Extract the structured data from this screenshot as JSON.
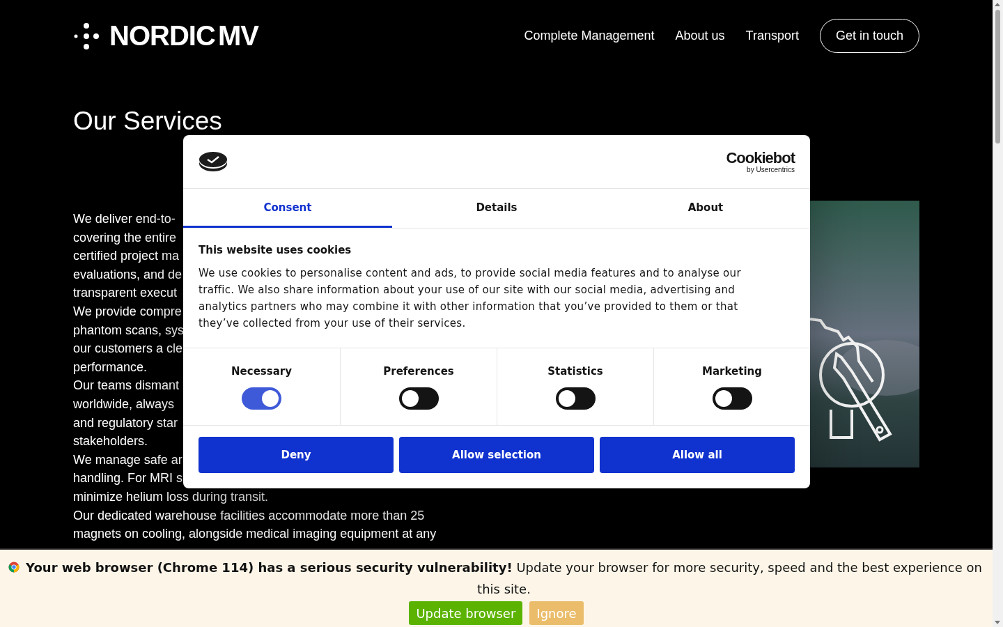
{
  "header": {
    "logo": "NORDIC MV",
    "nav": [
      "Complete Management",
      "About us",
      "Transport"
    ],
    "cta": "Get in touch"
  },
  "heading": "Our Services",
  "body_lines": [
    "We deliver end-to-",
    "covering the entire",
    "certified project ma",
    "evaluations, and de",
    "transparent execut",
    "We provide compre",
    "phantom scans, sys",
    "our customers a cle",
    "performance.",
    "Our teams dismant",
    "worldwide, always",
    "and regulatory star",
    "stakeholders.",
    "We manage safe ar",
    "handling. For MRI s",
    "minimize helium loss during transit.",
    "Our dedicated warehouse facilities accommodate more than 25",
    "magnets on cooling, alongside medical imaging equipment at any"
  ],
  "consent": {
    "brand": "Cookiebot",
    "brand_sub": "by Usercentrics",
    "tabs": [
      {
        "label": "Consent",
        "selected": true
      },
      {
        "label": "Details",
        "selected": false
      },
      {
        "label": "About",
        "selected": false
      }
    ],
    "title": "This website uses cookies",
    "text": "We use cookies to personalise content and ads, to provide social media features and to analyse our traffic. We also share information about your use of our site with our social media, advertising and analytics partners who may combine it with other information that you’ve provided to them or that they’ve collected from your use of their services.",
    "toggles": [
      {
        "label": "Necessary",
        "checked": true,
        "disabled": true
      },
      {
        "label": "Preferences",
        "checked": false,
        "disabled": false
      },
      {
        "label": "Statistics",
        "checked": false,
        "disabled": false
      },
      {
        "label": "Marketing",
        "checked": false,
        "disabled": false
      }
    ],
    "buttons": [
      "Deny",
      "Allow selection",
      "Allow all"
    ]
  },
  "banner": {
    "message": "**Your web browser (Chrome 114) has a serious security vulnerability!** Update your browser for more security, speed and the best experience on this site.",
    "update": "Update browser",
    "ignore": "Ignore"
  }
}
